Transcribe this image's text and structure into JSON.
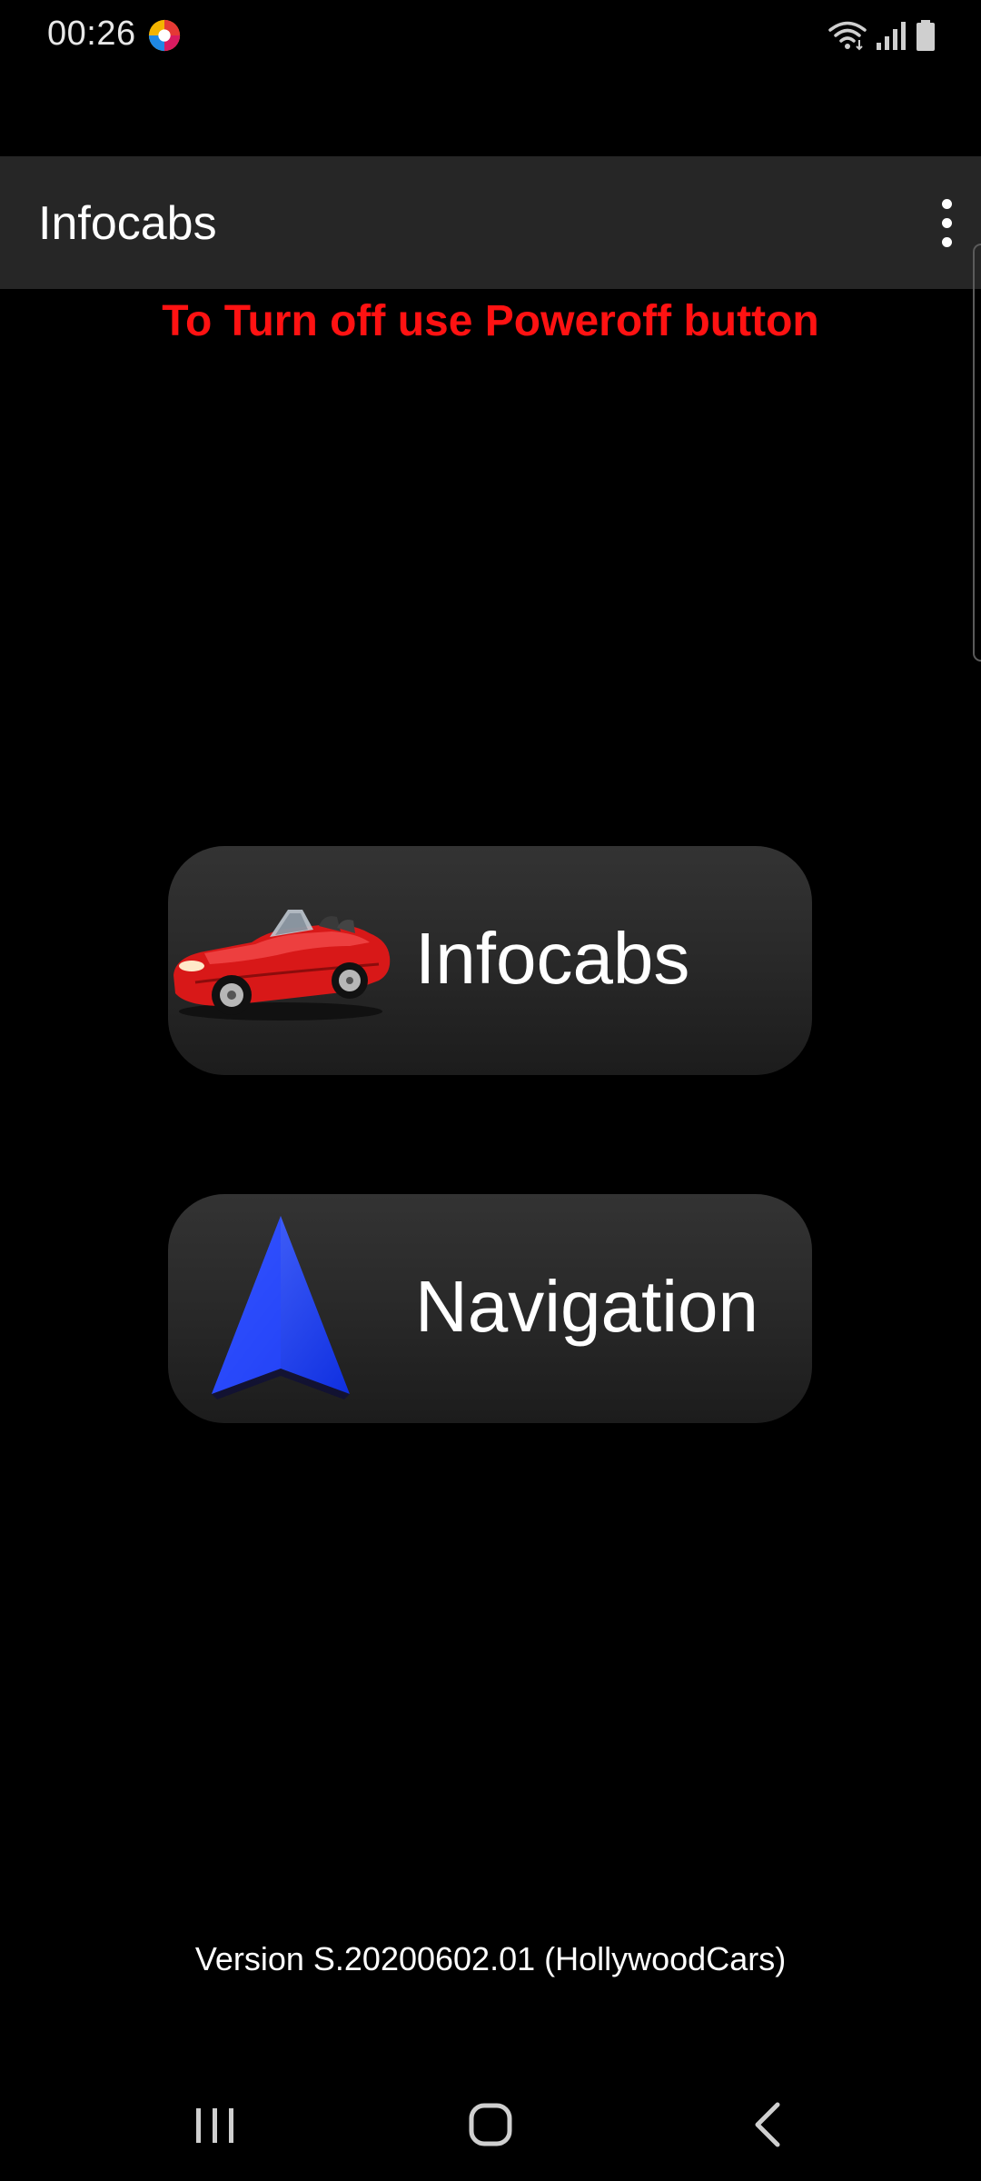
{
  "status_bar": {
    "time": "00:26",
    "app_icon": "colorful-circle-app-icon",
    "wifi_icon": "wifi-icon",
    "signal_icon": "signal-icon",
    "battery_icon": "battery-icon"
  },
  "app_bar": {
    "title": "Infocabs",
    "menu_icon": "more-vert-icon"
  },
  "warning": {
    "text": "To Turn off use Poweroff button",
    "color": "#ff1212"
  },
  "buttons": [
    {
      "label": "Infocabs",
      "icon": "red-car-icon"
    },
    {
      "label": "Navigation",
      "icon": "blue-arrow-icon"
    }
  ],
  "version": {
    "text": "Version S.20200602.01 (HollywoodCars)"
  },
  "nav_bar": {
    "recents_icon": "recents-icon",
    "home_icon": "home-icon",
    "back_icon": "back-icon"
  },
  "colors": {
    "background": "#000000",
    "app_bar": "#262626",
    "button": "#2a2a2a",
    "navigation_arrow": "#1a3cff",
    "car": "#d81818"
  }
}
